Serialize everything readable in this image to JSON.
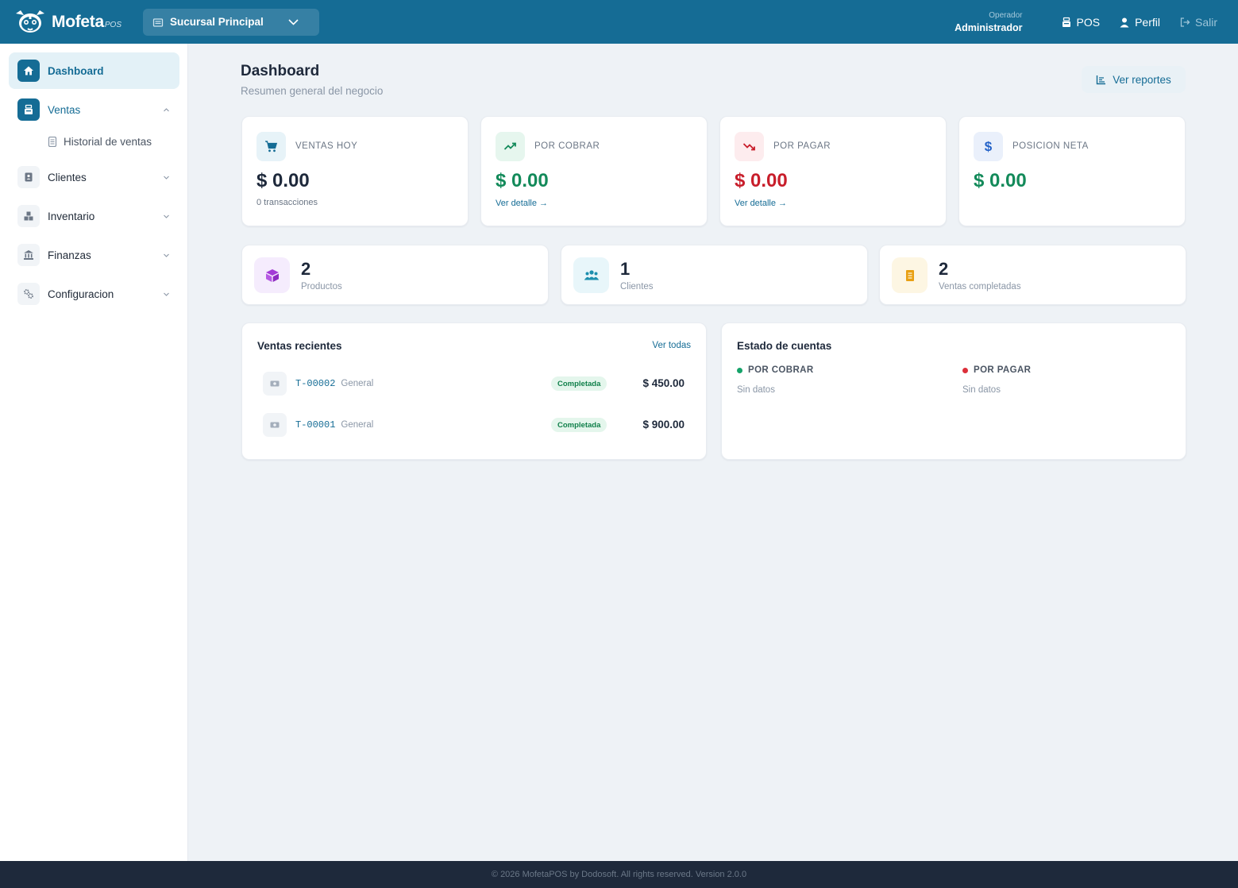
{
  "app": {
    "brand": "Mofeta",
    "brand_sub": "POS",
    "branch": "Sucursal Principal",
    "operator_label": "Operador",
    "operator_name": "Administrador",
    "pos_label": "POS",
    "profile_label": "Perfil",
    "logout_label": "Salir",
    "primary_color": "#156c95"
  },
  "sidebar": {
    "items": [
      {
        "label": "Dashboard",
        "icon": "home-icon",
        "active": true
      },
      {
        "label": "Ventas",
        "icon": "register-icon",
        "expanded": true
      },
      {
        "label": "Clientes",
        "icon": "contact-icon"
      },
      {
        "label": "Inventario",
        "icon": "boxes-icon"
      },
      {
        "label": "Finanzas",
        "icon": "bank-icon"
      },
      {
        "label": "Configuracion",
        "icon": "gears-icon"
      }
    ],
    "sub_item": {
      "label": "Historial de ventas",
      "icon": "receipt-icon"
    }
  },
  "page": {
    "title": "Dashboard",
    "subtitle": "Resumen general del negocio",
    "reports_button": "Ver reportes"
  },
  "stats": [
    {
      "label": "VENTAS HOY",
      "value": "$ 0.00",
      "foot": "0 transacciones",
      "icon": "cart-icon",
      "value_color": "#1e293b"
    },
    {
      "label": "POR COBRAR",
      "value": "$ 0.00",
      "link": "Ver detalle →",
      "icon": "trend-up-icon",
      "value_color": "#138a5a"
    },
    {
      "label": "POR PAGAR",
      "value": "$ 0.00",
      "link": "Ver detalle →",
      "icon": "trend-down-icon",
      "value_color": "#c81e2b"
    },
    {
      "label": "POSICION NETA",
      "value": "$ 0.00",
      "icon": "dollar-icon",
      "value_color": "#138a5a"
    }
  ],
  "counts": [
    {
      "number": "2",
      "label": "Productos",
      "icon": "box-icon"
    },
    {
      "number": "1",
      "label": "Clientes",
      "icon": "users-icon"
    },
    {
      "number": "2",
      "label": "Ventas completadas",
      "icon": "receipt-icon"
    }
  ],
  "recent_sales": {
    "title": "Ventas recientes",
    "view_all": "Ver todas",
    "rows": [
      {
        "code": "T-00002",
        "client": "General",
        "status": "Completada",
        "amount": "$ 450.00"
      },
      {
        "code": "T-00001",
        "client": "General",
        "status": "Completada",
        "amount": "$ 900.00"
      }
    ]
  },
  "accounts": {
    "title": "Estado de cuentas",
    "receivable": {
      "label": "POR COBRAR",
      "empty": "Sin datos",
      "color": "#16a36a"
    },
    "payable": {
      "label": "POR PAGAR",
      "empty": "Sin datos",
      "color": "#dc2f3a"
    }
  },
  "footer": {
    "text": "© 2026 MofetaPOS by Dodosoft. All rights reserved. Version 2.0.0"
  }
}
